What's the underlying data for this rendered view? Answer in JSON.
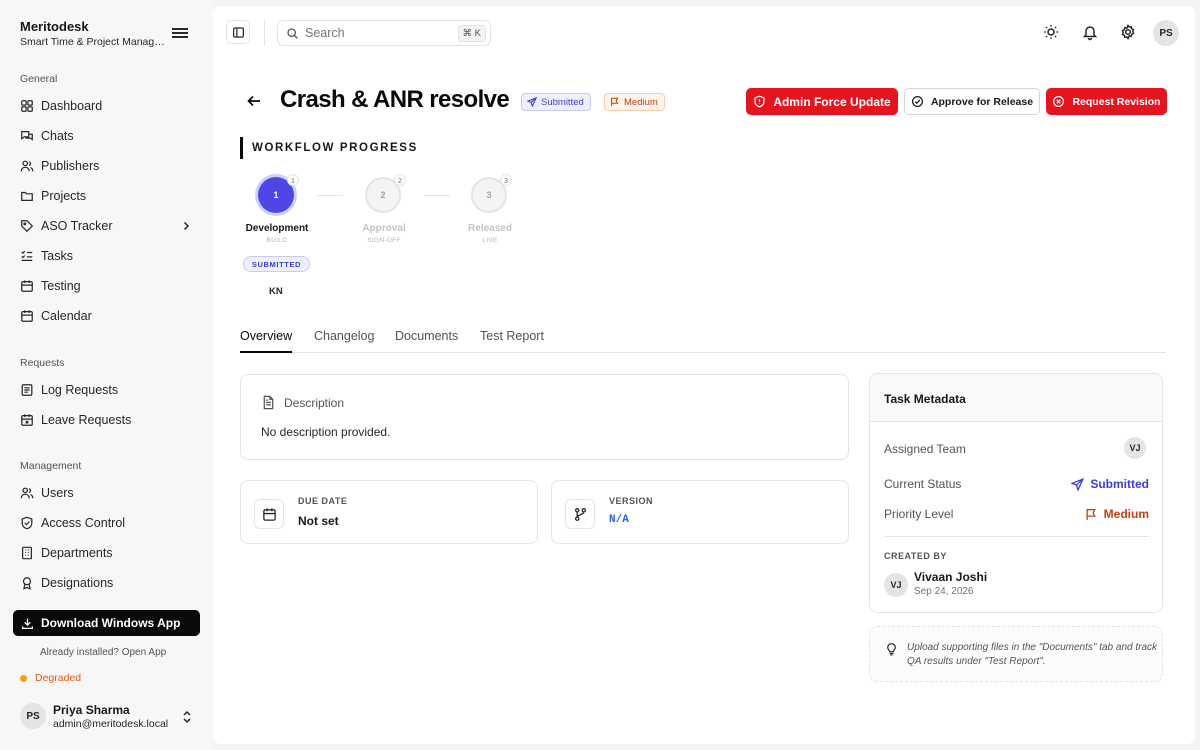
{
  "brand": {
    "name": "Meritodesk",
    "subtitle": "Smart Time & Project Management"
  },
  "sidebar": {
    "sections": [
      {
        "label": "General",
        "items": [
          {
            "label": "Dashboard",
            "icon": "grid-icon"
          },
          {
            "label": "Chats",
            "icon": "chat-icon"
          },
          {
            "label": "Publishers",
            "icon": "users-icon"
          },
          {
            "label": "Projects",
            "icon": "folder-icon"
          },
          {
            "label": "ASO Tracker",
            "icon": "tag-icon"
          },
          {
            "label": "Tasks",
            "icon": "checklist-icon"
          },
          {
            "label": "Testing",
            "icon": "calendar-icon"
          },
          {
            "label": "Calendar",
            "icon": "calendar-icon"
          }
        ]
      },
      {
        "label": "Requests",
        "items": [
          {
            "label": "Log Requests",
            "icon": "list-icon"
          },
          {
            "label": "Leave Requests",
            "icon": "calendar-x-icon"
          }
        ]
      },
      {
        "label": "Management",
        "items": [
          {
            "label": "Users",
            "icon": "users-icon"
          },
          {
            "label": "Access Control",
            "icon": "shield-icon"
          },
          {
            "label": "Departments",
            "icon": "building-icon"
          },
          {
            "label": "Designations",
            "icon": "badge-icon"
          }
        ]
      }
    ],
    "download_label": "Download Windows App",
    "installed_text": "Already installed? Open App",
    "status_text": "Degraded",
    "user": {
      "initials": "PS",
      "name": "Priya Sharma",
      "email": "admin@meritodesk.local"
    }
  },
  "topbar": {
    "search_placeholder": "Search",
    "search_shortcut": "⌘ K",
    "avatar_initials": "PS"
  },
  "task": {
    "title": "Crash & ANR resolve",
    "status_badge": "Submitted",
    "priority_badge": "Medium",
    "actions": {
      "force_update": "Admin Force Update",
      "approve": "Approve for Release",
      "revision": "Request Revision"
    }
  },
  "workflow": {
    "title": "WORKFLOW PROGRESS",
    "steps": [
      {
        "number": "1",
        "label": "Development",
        "sub": "BUILD"
      },
      {
        "number": "2",
        "label": "Approval",
        "sub": "SIGN-OFF"
      },
      {
        "number": "3",
        "label": "Released",
        "sub": "LIVE"
      }
    ],
    "current_status_pill": "SUBMITTED",
    "assignee_initials": "KN"
  },
  "tabs": [
    "Overview",
    "Changelog",
    "Documents",
    "Test Report"
  ],
  "description": {
    "heading": "Description",
    "text": "No description provided."
  },
  "due_date": {
    "label": "DUE DATE",
    "value": "Not set"
  },
  "version": {
    "label": "VERSION",
    "value": "N/A"
  },
  "metadata": {
    "title": "Task Metadata",
    "assigned_team_label": "Assigned Team",
    "assigned_team_initials": "VJ",
    "current_status_label": "Current Status",
    "current_status_value": "Submitted",
    "priority_label": "Priority Level",
    "priority_value": "Medium",
    "created_by_label": "CREATED BY",
    "creator_initials": "VJ",
    "creator_name": "Vivaan Joshi",
    "created_date": "Sep 24, 2026"
  },
  "tip": "Upload supporting files in the \"Documents\" tab and track QA results under \"Test Report\".",
  "colors": {
    "accent": "#4f46e5",
    "danger": "#e5141e",
    "warning": "#c2410c",
    "status_dot": "#f59e0b"
  }
}
